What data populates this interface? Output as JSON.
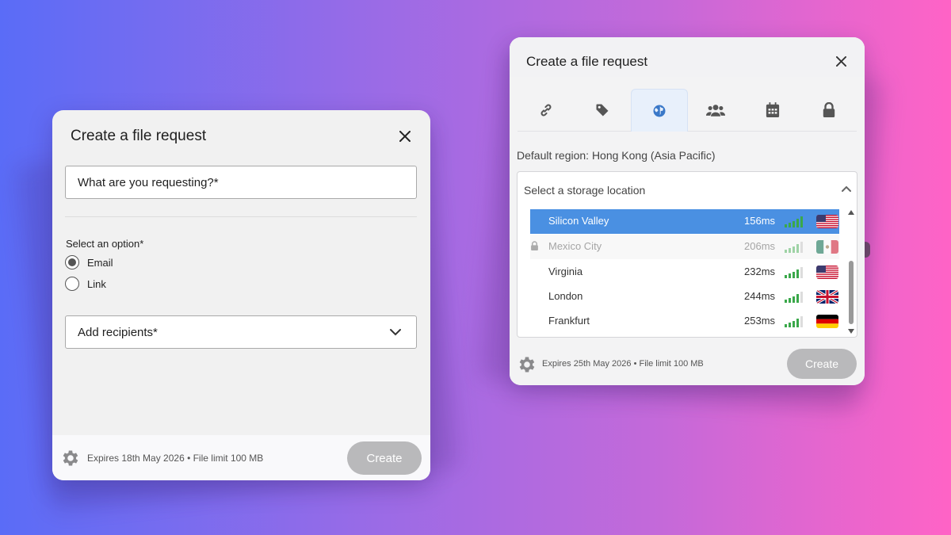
{
  "colors": {
    "accent": "#4a90e2",
    "create_disabled": "#b9b9bb",
    "signal_green": "#3aa84a"
  },
  "left_dialog": {
    "title": "Create a file request",
    "request_placeholder": "What are you requesting?*",
    "option_label": "Select an option*",
    "options": [
      {
        "label": "Email",
        "selected": true
      },
      {
        "label": "Link",
        "selected": false
      }
    ],
    "recipients_label": "Add recipients*",
    "footer_text": "Expires 18th May 2026 • File limit 100 MB",
    "create_label": "Create"
  },
  "right_dialog": {
    "title": "Create a file request",
    "tabs": [
      {
        "icon": "link-icon",
        "active": false
      },
      {
        "icon": "tag-icon",
        "active": false
      },
      {
        "icon": "globe-icon",
        "active": true
      },
      {
        "icon": "users-icon",
        "active": false
      },
      {
        "icon": "calendar-icon",
        "active": false
      },
      {
        "icon": "lock-icon",
        "active": false
      }
    ],
    "default_region": "Default region: Hong Kong (Asia Pacific)",
    "storage_placeholder": "Select a storage location",
    "locations": [
      {
        "name": "Silicon Valley",
        "latency": "156ms",
        "flag": "us-flag-icon",
        "selected": true,
        "locked": false
      },
      {
        "name": "Mexico City",
        "latency": "206ms",
        "flag": "mx-flag-icon",
        "selected": false,
        "locked": true
      },
      {
        "name": "Virginia",
        "latency": "232ms",
        "flag": "us-flag-icon",
        "selected": false,
        "locked": false
      },
      {
        "name": "London",
        "latency": "244ms",
        "flag": "uk-flag-icon",
        "selected": false,
        "locked": false
      },
      {
        "name": "Frankfurt",
        "latency": "253ms",
        "flag": "de-flag-icon",
        "selected": false,
        "locked": false
      }
    ],
    "footer_text": "Expires 25th May 2026 • File limit 100 MB",
    "create_label": "Create"
  }
}
